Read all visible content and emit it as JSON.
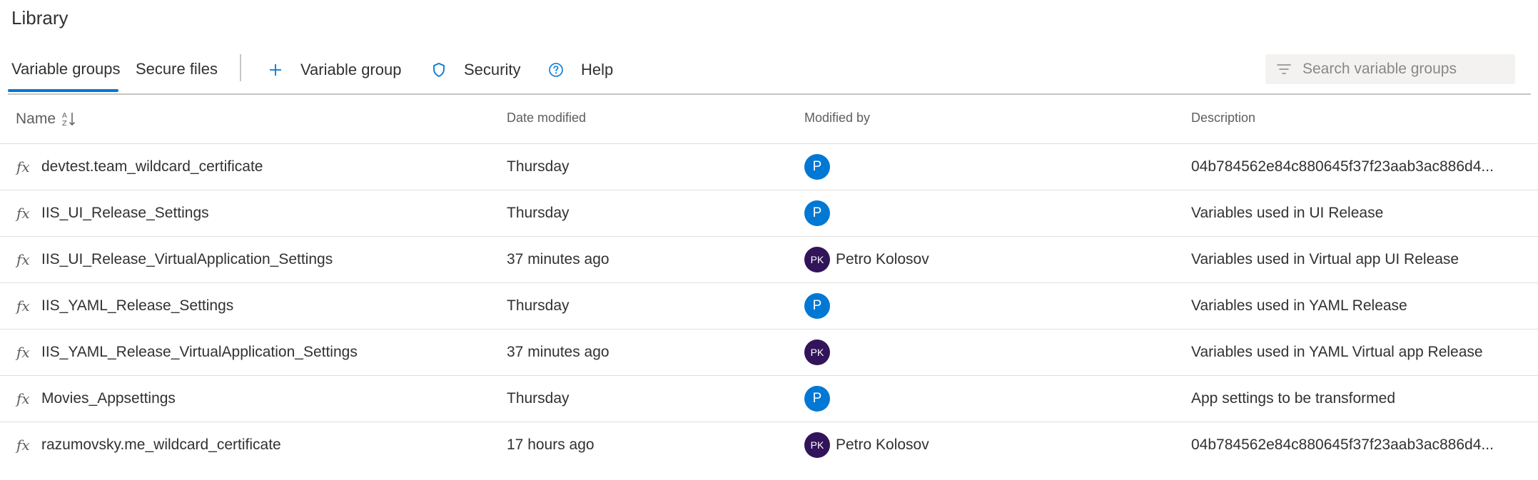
{
  "page": {
    "title": "Library"
  },
  "tabs": [
    {
      "label": "Variable groups",
      "active": true
    },
    {
      "label": "Secure files",
      "active": false
    }
  ],
  "commands": {
    "add_variable_group": "Variable group",
    "security": "Security",
    "help": "Help"
  },
  "search": {
    "placeholder": "Search variable groups",
    "value": ""
  },
  "columns": {
    "name": "Name",
    "date_modified": "Date modified",
    "modified_by": "Modified by",
    "description": "Description"
  },
  "rows": [
    {
      "name": "devtest.team_wildcard_certificate",
      "date": "Thursday",
      "avatar_initials": "P",
      "avatar_color": "#0078d4",
      "modified_by": "",
      "description": "04b784562e84c880645f37f23aab3ac886d4..."
    },
    {
      "name": "IIS_UI_Release_Settings",
      "date": "Thursday",
      "avatar_initials": "P",
      "avatar_color": "#0078d4",
      "modified_by": "",
      "description": "Variables used in UI Release"
    },
    {
      "name": "IIS_UI_Release_VirtualApplication_Settings",
      "date": "37 minutes ago",
      "avatar_initials": "PK",
      "avatar_color": "#32145a",
      "modified_by": "Petro Kolosov",
      "description": "Variables used in Virtual app UI Release"
    },
    {
      "name": "IIS_YAML_Release_Settings",
      "date": "Thursday",
      "avatar_initials": "P",
      "avatar_color": "#0078d4",
      "modified_by": "",
      "description": "Variables used in YAML Release"
    },
    {
      "name": "IIS_YAML_Release_VirtualApplication_Settings",
      "date": "37 minutes ago",
      "avatar_initials": "PK",
      "avatar_color": "#32145a",
      "modified_by": "",
      "description": "Variables used in YAML Virtual app Release"
    },
    {
      "name": "Movies_Appsettings",
      "date": "Thursday",
      "avatar_initials": "P",
      "avatar_color": "#0078d4",
      "modified_by": "",
      "description": "App settings to be transformed"
    },
    {
      "name": "razumovsky.me_wildcard_certificate",
      "date": "17 hours ago",
      "avatar_initials": "PK",
      "avatar_color": "#32145a",
      "modified_by": "Petro Kolosov",
      "description": "04b784562e84c880645f37f23aab3ac886d4..."
    }
  ],
  "icons": {
    "row_icon": "function-fx-icon",
    "sort": "sort-ascending-icon",
    "add": "plus-icon",
    "security": "shield-icon",
    "help": "help-circle-icon",
    "search": "filter-icon"
  },
  "colors": {
    "accent": "#0078d4",
    "avatar_blue": "#0078d4",
    "avatar_purple": "#32145a"
  }
}
